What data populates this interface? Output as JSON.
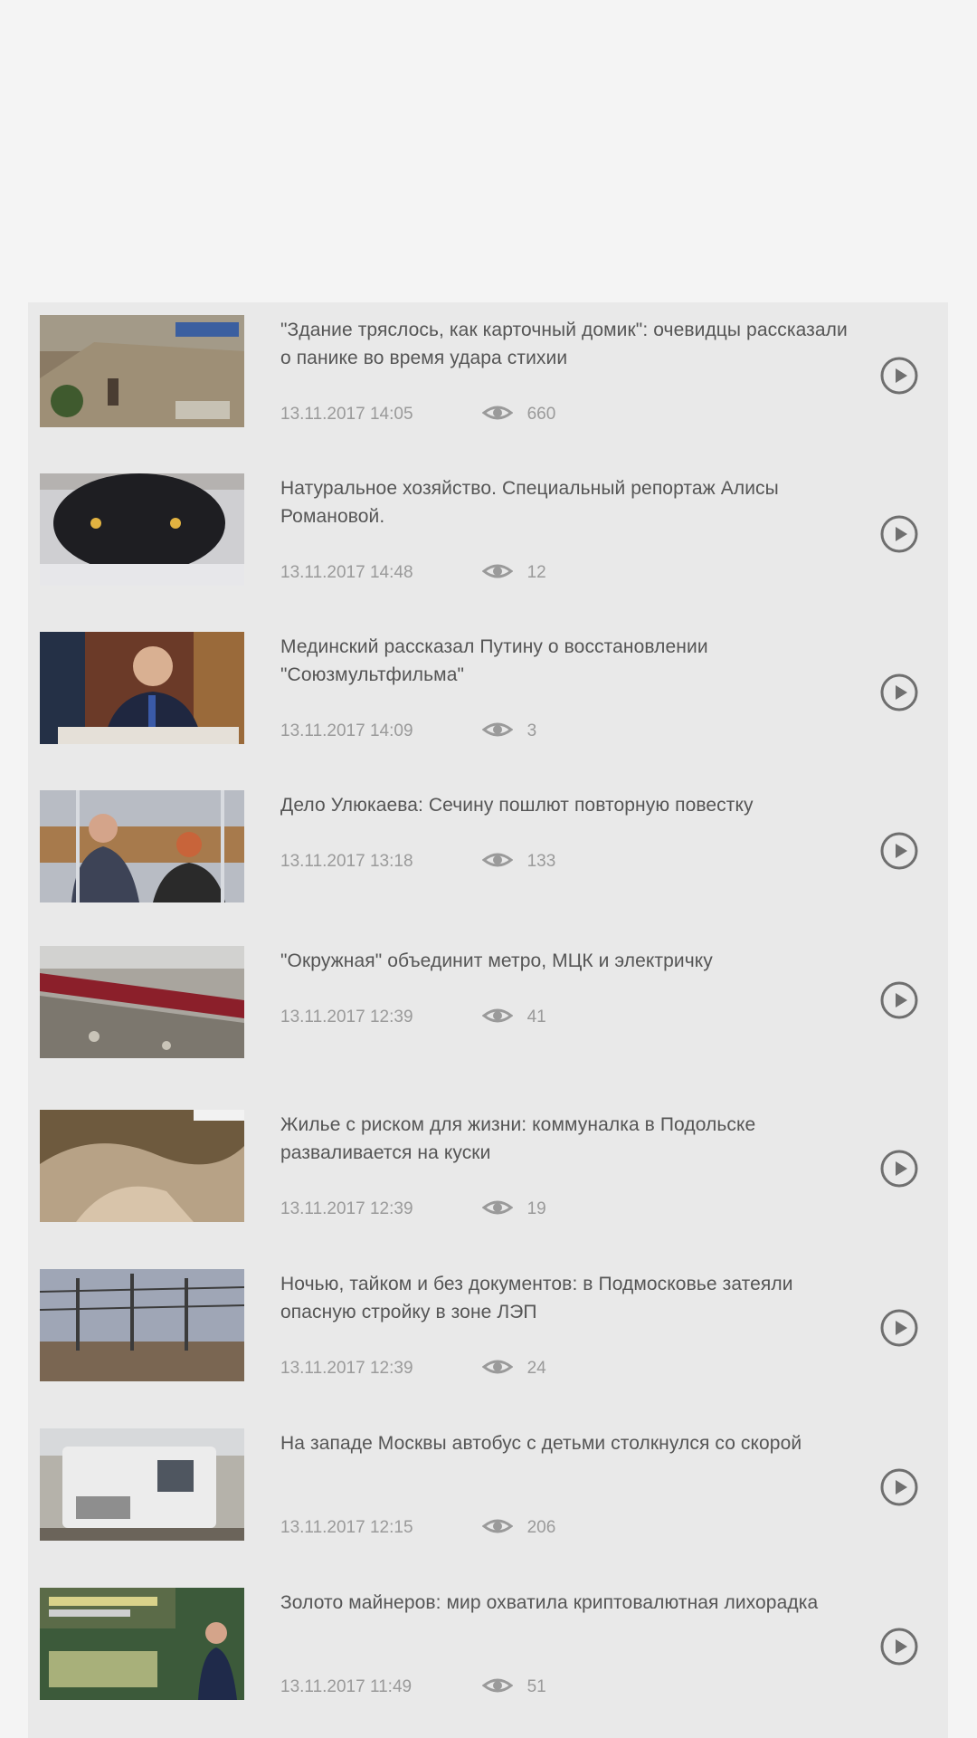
{
  "colors": {
    "page_background": "#f4f4f4",
    "list_background": "#e9e9e9",
    "title_text": "#555555",
    "meta_text": "#9a9a9a",
    "icon": "#6f6f6f"
  },
  "icons": {
    "views": "eye-icon",
    "play": "play-circle-icon"
  },
  "videos": [
    {
      "title": "\"Здание тряслось, как карточный домик\": очевидцы рассказали о панике во время удара стихии",
      "date": "13.11.2017 14:05",
      "views": "660"
    },
    {
      "title": "Натуральное хозяйство. Специальный репортаж Алисы Романовой.",
      "date": "13.11.2017 14:48",
      "views": "12"
    },
    {
      "title": "Мединский рассказал Путину о восстановлении \"Союзмультфильма\"",
      "date": "13.11.2017 14:09",
      "views": "3"
    },
    {
      "title": "Дело Улюкаева: Сечину пошлют повторную повестку",
      "date": "13.11.2017 13:18",
      "views": "133"
    },
    {
      "title": "\"Окружная\" объединит метро, МЦК и электричку",
      "date": "13.11.2017 12:39",
      "views": "41"
    },
    {
      "title": "Жилье с риском для жизни: коммуналка в Подольске разваливается на куски",
      "date": "13.11.2017 12:39",
      "views": "19"
    },
    {
      "title": "Ночью, тайком и без документов: в Подмосковье затеяли опасную стройку в зоне ЛЭП",
      "date": "13.11.2017 12:39",
      "views": "24"
    },
    {
      "title": "На западе Москвы автобус с детьми столкнулся со скорой",
      "date": "13.11.2017 12:15",
      "views": "206"
    },
    {
      "title": "Золото майнеров: мир охватила криптовалютная лихорадка",
      "date": "13.11.2017 11:49",
      "views": "51"
    }
  ]
}
